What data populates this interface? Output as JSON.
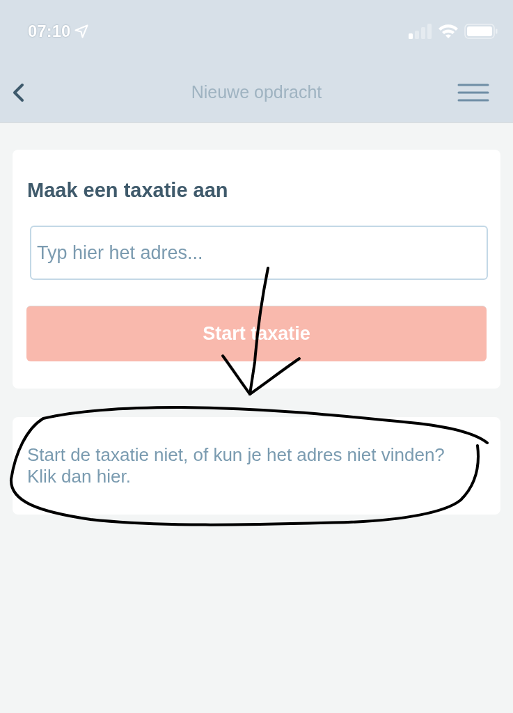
{
  "status_bar": {
    "time": "07:10"
  },
  "nav_bar": {
    "title": "Nieuwe opdracht"
  },
  "create_card": {
    "title": "Maak een taxatie aan",
    "address_field": {
      "placeholder": "Typ hier het adres..."
    },
    "start_button": {
      "label": "Start taxatie",
      "disabled": true
    }
  },
  "help_card": {
    "text": "Start de taxatie niet, of kun je het adres niet vinden?\nKlik dan hier."
  }
}
